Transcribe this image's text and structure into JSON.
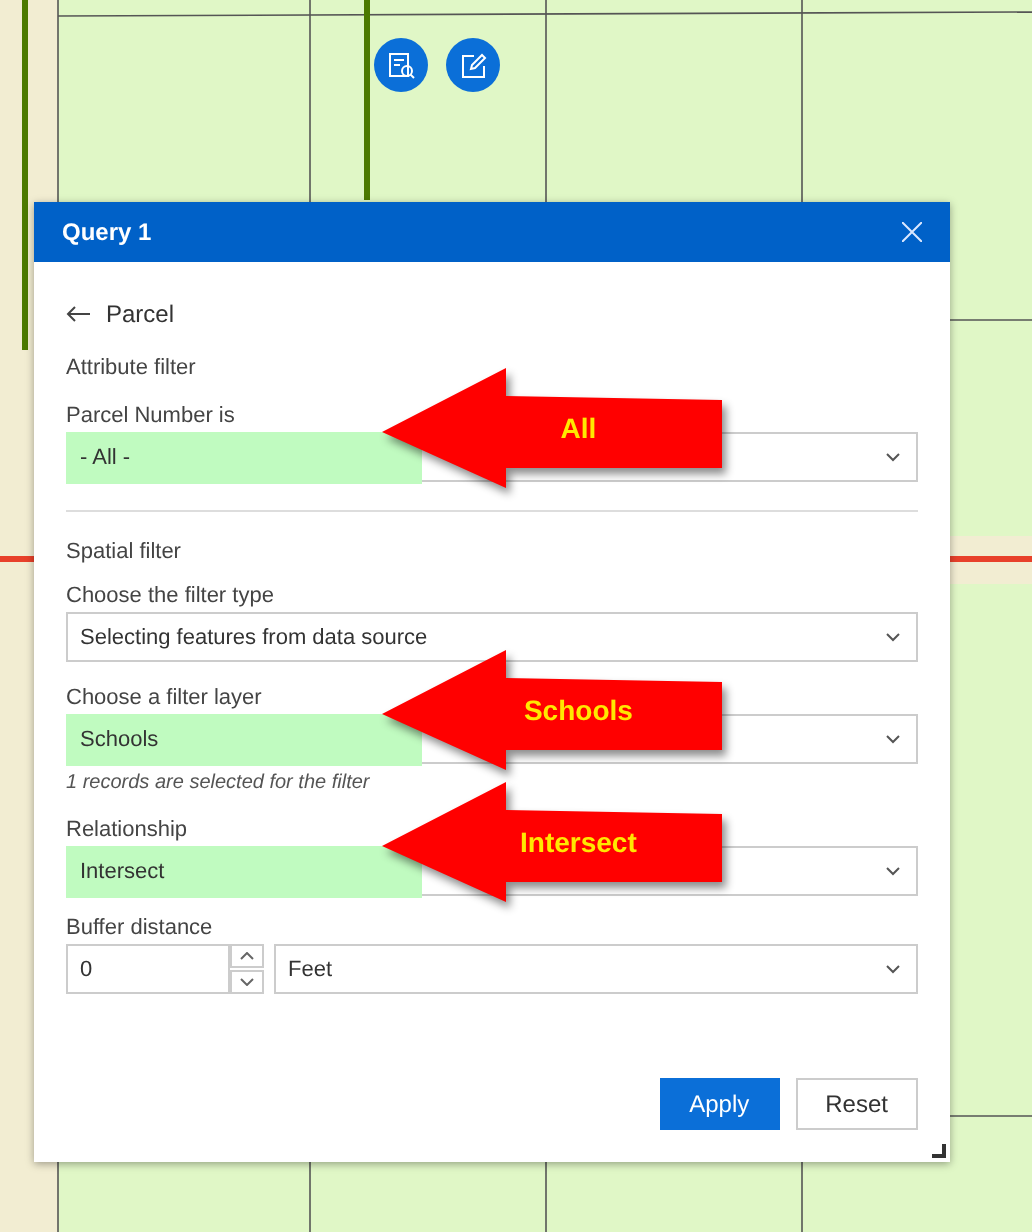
{
  "map": {
    "tool_buttons": [
      {
        "kind": "query"
      },
      {
        "kind": "edit"
      }
    ]
  },
  "dialog": {
    "title": "Query 1",
    "back_label": "Parcel",
    "attribute_filter": {
      "heading": "Attribute filter",
      "fields": [
        {
          "label": "Parcel Number is",
          "value": "- All -",
          "highlighted": true,
          "callout": "All"
        }
      ]
    },
    "spatial_filter": {
      "heading": "Spatial filter",
      "fields": [
        {
          "label": "Choose the filter type",
          "value": "Selecting features from data source",
          "highlighted": false
        },
        {
          "label": "Choose a filter layer",
          "value": "Schools",
          "highlighted": true,
          "callout": "Schools",
          "note": "1 records are selected for the filter"
        },
        {
          "label": "Relationship",
          "value": "Intersect",
          "highlighted": true,
          "callout": "Intersect"
        }
      ],
      "buffer": {
        "label": "Buffer distance",
        "value": "0",
        "unit": "Feet"
      }
    },
    "buttons": [
      {
        "label": "Apply",
        "primary": true
      },
      {
        "label": "Reset",
        "primary": false
      }
    ]
  }
}
